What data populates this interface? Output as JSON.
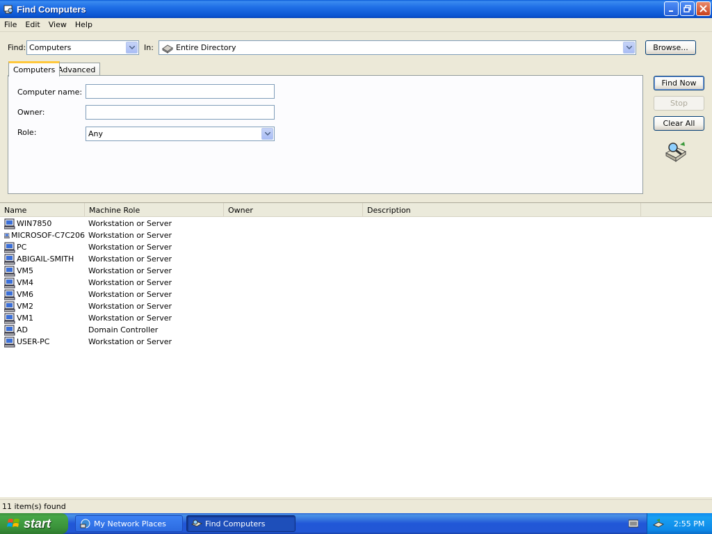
{
  "window": {
    "title": "Find Computers"
  },
  "menu": [
    "File",
    "Edit",
    "View",
    "Help"
  ],
  "find_row": {
    "find_label": "Find:",
    "find_value": "Computers",
    "in_label": "In:",
    "in_value": "Entire Directory",
    "browse_label": "Browse..."
  },
  "tabs": [
    "Computers",
    "Advanced"
  ],
  "form": {
    "computer_name_label": "Computer name:",
    "computer_name_value": "",
    "owner_label": "Owner:",
    "owner_value": "",
    "role_label": "Role:",
    "role_value": "Any"
  },
  "actions": {
    "find_now": "Find Now",
    "stop": "Stop",
    "clear_all": "Clear All"
  },
  "results": {
    "columns": [
      "Name",
      "Machine Role",
      "Owner",
      "Description"
    ],
    "rows": [
      {
        "name": "WIN7850",
        "role": "Workstation or Server"
      },
      {
        "name": "MICROSOF-C7C206",
        "role": "Workstation or Server"
      },
      {
        "name": "PC",
        "role": "Workstation or Server"
      },
      {
        "name": "ABIGAIL-SMITH",
        "role": "Workstation or Server"
      },
      {
        "name": "VM5",
        "role": "Workstation or Server"
      },
      {
        "name": "VM4",
        "role": "Workstation or Server"
      },
      {
        "name": "VM6",
        "role": "Workstation or Server"
      },
      {
        "name": "VM2",
        "role": "Workstation or Server"
      },
      {
        "name": "VM1",
        "role": "Workstation or Server"
      },
      {
        "name": "AD",
        "role": "Domain Controller"
      },
      {
        "name": "USER-PC",
        "role": "Workstation or Server"
      }
    ]
  },
  "status": "11 item(s) found",
  "taskbar": {
    "start": "start",
    "tasks": [
      "My Network Places",
      "Find Computers"
    ],
    "clock": "2:55 PM"
  }
}
